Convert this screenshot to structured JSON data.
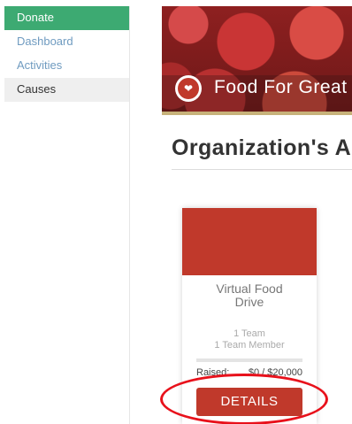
{
  "sidebar": {
    "items": [
      {
        "label": "Donate"
      },
      {
        "label": "Dashboard"
      },
      {
        "label": "Activities"
      },
      {
        "label": "Causes"
      }
    ]
  },
  "hero": {
    "title": "Food For Great"
  },
  "section": {
    "title": "Organization's Ac"
  },
  "card": {
    "title_line1": "Virtual Food",
    "title_line2": "Drive",
    "teams": "1 Team",
    "members": "1 Team Member",
    "raised_label": "Raised:",
    "raised_value": "$0 / $20,000",
    "progress_fraction": 0,
    "details_label": "DETAILS"
  },
  "colors": {
    "donate_green": "#3daa72",
    "cause_red": "#c0392b",
    "highlight_red": "#e8111b",
    "link_blue": "#6f9bc0"
  }
}
